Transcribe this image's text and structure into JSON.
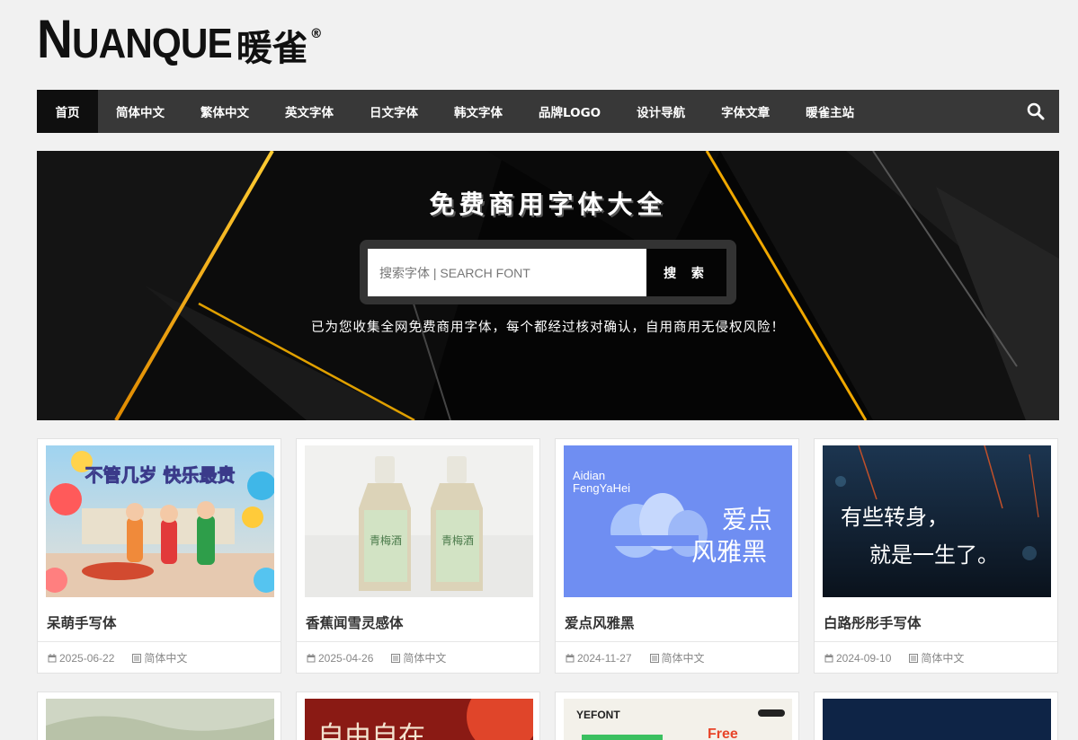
{
  "logo": {
    "text_big": "N",
    "text_rest": "UANQUE",
    "text_cn": "暖雀",
    "reg": "®"
  },
  "nav": {
    "items": [
      "首页",
      "简体中文",
      "繁体中文",
      "英文字体",
      "日文字体",
      "韩文字体",
      "品牌LOGO",
      "设计导航",
      "字体文章",
      "暖雀主站"
    ],
    "active_index": 0,
    "search_icon": "search-icon"
  },
  "banner": {
    "title": "免费商用字体大全",
    "search_placeholder": "搜索字体 | SEARCH FONT",
    "search_button": "搜 索",
    "subtitle": "已为您收集全网免费商用字体，每个都经过核对确认，自用商用无侵权风险！"
  },
  "cards": [
    {
      "title": "呆萌手写体",
      "date": "2025-06-22",
      "category": "简体中文",
      "image_text": "不管几岁 快乐最贵"
    },
    {
      "title": "香蕉闻雪灵感体",
      "date": "2025-04-26",
      "category": "简体中文",
      "image_text": "青梅酒"
    },
    {
      "title": "爱点风雅黑",
      "date": "2024-11-27",
      "category": "简体中文",
      "image_text_en1": "Aidian",
      "image_text_en2": "FengYaHei",
      "image_text_cn1": "爱点",
      "image_text_cn2": "风雅黑"
    },
    {
      "title": "白路彤彤手写体",
      "date": "2024-09-10",
      "category": "简体中文",
      "image_text1": "有些转身，",
      "image_text2": "就是一生了。"
    }
  ],
  "cards_row2": [
    {
      "image_text": ""
    },
    {
      "image_text": "自由自在"
    },
    {
      "image_text": "YEFONT",
      "image_text2": "Free"
    },
    {
      "image_text": ""
    }
  ],
  "colors": {
    "nav_bg": "#383838",
    "nav_active": "#0f0f0f",
    "banner_bg": "#050505",
    "accent_gold": "#f5a623",
    "page_bg": "#f1f1f1"
  }
}
